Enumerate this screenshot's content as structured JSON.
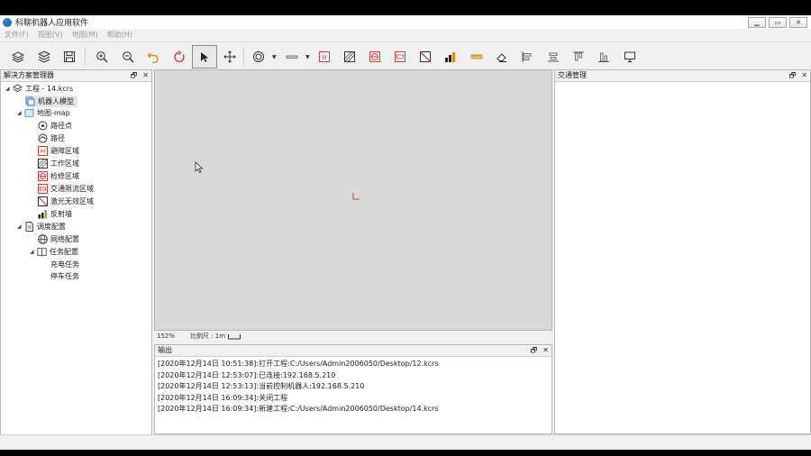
{
  "window": {
    "title": "科聊机器人应用软件",
    "buttons": [
      "▁",
      "▭",
      "✕"
    ]
  },
  "menu": [
    "文件(F)",
    "视图(V)",
    "地图(M)",
    "帮助(H)"
  ],
  "toolbar": {
    "tools": [
      "layers",
      "layers-stack",
      "save",
      "zoom-in",
      "zoom-out",
      "undo",
      "redo",
      "select",
      "move",
      "target",
      "line",
      "obstacle-area",
      "work-area",
      "maintain-area",
      "speed-limit-area",
      "laser-invalid-area",
      "reflector",
      "ruler",
      "eraser",
      "align-left",
      "align-center",
      "align-top",
      "align-bottom",
      "monitor"
    ],
    "active": "select",
    "colors": {
      "orange": "#e8861a",
      "red": "#e03b2e",
      "dark": "#333333"
    }
  },
  "solution_panel": {
    "title": "解决方案管理器",
    "tree": [
      {
        "label": "工程 - 14.kcrs",
        "level": 0,
        "icon": "layers-icon",
        "expanded": true
      },
      {
        "label": "机器人模型",
        "level": 1,
        "icon": "robot-model-icon",
        "selected": true
      },
      {
        "label": "地图-map",
        "level": 1,
        "icon": "map-icon",
        "expanded": true
      },
      {
        "label": "路径点",
        "level": 2,
        "icon": "waypoint-icon"
      },
      {
        "label": "路径",
        "level": 2,
        "icon": "path-icon"
      },
      {
        "label": "避障区域",
        "level": 2,
        "icon": "obstacle-area-icon"
      },
      {
        "label": "工作区域",
        "level": 2,
        "icon": "work-area-icon"
      },
      {
        "label": "检修区域",
        "level": 2,
        "icon": "maintain-area-icon"
      },
      {
        "label": "交通限流区域",
        "level": 2,
        "icon": "speed-limit-area-icon"
      },
      {
        "label": "激光无效区域",
        "level": 2,
        "icon": "laser-invalid-area-icon"
      },
      {
        "label": "反射墙",
        "level": 2,
        "icon": "reflector-icon"
      },
      {
        "label": "调度配置",
        "level": 1,
        "icon": "document-icon",
        "expanded": true
      },
      {
        "label": "网络配置",
        "level": 2,
        "icon": "globe-icon"
      },
      {
        "label": "任务配置",
        "level": 2,
        "icon": "book-icon",
        "expanded": true
      },
      {
        "label": "充电任务",
        "level": 3,
        "icon": ""
      },
      {
        "label": "停车任务",
        "level": 3,
        "icon": ""
      }
    ]
  },
  "canvas": {
    "zoom": "152%",
    "scale_label": "比例尺 : 1m"
  },
  "output_panel": {
    "title": "输出",
    "lines": [
      "[2020年12月14日 10:51:38]:打开工程:C:/Users/Admin2006050/Desktop/12.kcrs",
      "[2020年12月14日 12:53:07]:已连接:192.168.5.210",
      "[2020年12月14日 12:53:13]:当前控制机器人:192.168.5.210",
      "[2020年12月14日 16:09:34]:关闭工程",
      "[2020年12月14日 16:09:34]:新建工程:C:/Users/Admin2006050/Desktop/14.kcrs"
    ]
  },
  "traffic_panel": {
    "title": "交通管理"
  },
  "panel_buttons": {
    "float": "🗗",
    "close": "✕"
  }
}
